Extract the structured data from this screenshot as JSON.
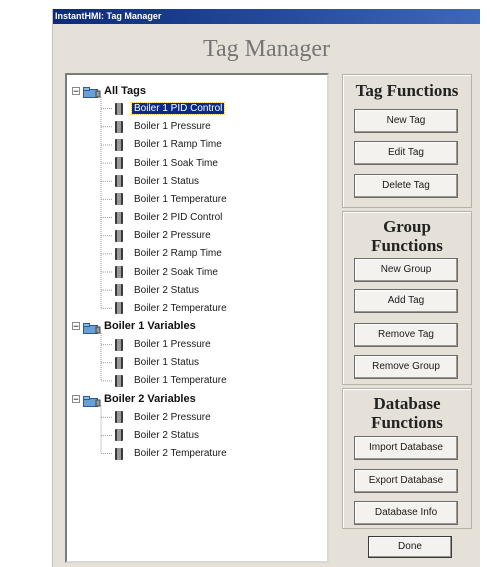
{
  "window": {
    "title": "InstantHMI: Tag Manager",
    "heading": "Tag Manager"
  },
  "tree": {
    "groups": [
      {
        "label": "All Tags",
        "expander": "−",
        "items": [
          "Boiler 1 PID Control",
          "Boiler 1 Pressure",
          "Boiler 1 Ramp Time",
          "Boiler 1 Soak Time",
          "Boiler 1 Status",
          "Boiler 1 Temperature",
          "Boiler 2 PID Control",
          "Boiler 2 Pressure",
          "Boiler 2 Ramp Time",
          "Boiler 2 Soak Time",
          "Boiler 2 Status",
          "Boiler 2 Temperature"
        ]
      },
      {
        "label": "Boiler 1 Variables",
        "expander": "−",
        "items": [
          "Boiler 1 Pressure",
          "Boiler 1 Status",
          "Boiler 1 Temperature"
        ]
      },
      {
        "label": "Boiler 2 Variables",
        "expander": "−",
        "items": [
          "Boiler 2 Pressure",
          "Boiler 2 Status",
          "Boiler 2 Temperature"
        ]
      }
    ],
    "selected": "Boiler 1 PID Control"
  },
  "panels": {
    "tag_functions": {
      "title": "Tag Functions",
      "buttons": [
        "New Tag",
        "Edit Tag",
        "Delete Tag"
      ]
    },
    "group_functions": {
      "title": "Group Functions",
      "buttons": [
        "New Group",
        "Add Tag",
        "Remove Tag",
        "Remove Group"
      ]
    },
    "database_functions": {
      "title": "Database Functions",
      "buttons": [
        "Import Database",
        "Export Database",
        "Database Info"
      ]
    }
  },
  "done_label": "Done",
  "colors": {
    "titlebar": "#0b2a7a",
    "selection": "#0a2a8a",
    "dialog_bg": "#e6e1d8"
  },
  "icons": {
    "group": "folder-tags-icon",
    "tag": "tag-icon"
  }
}
